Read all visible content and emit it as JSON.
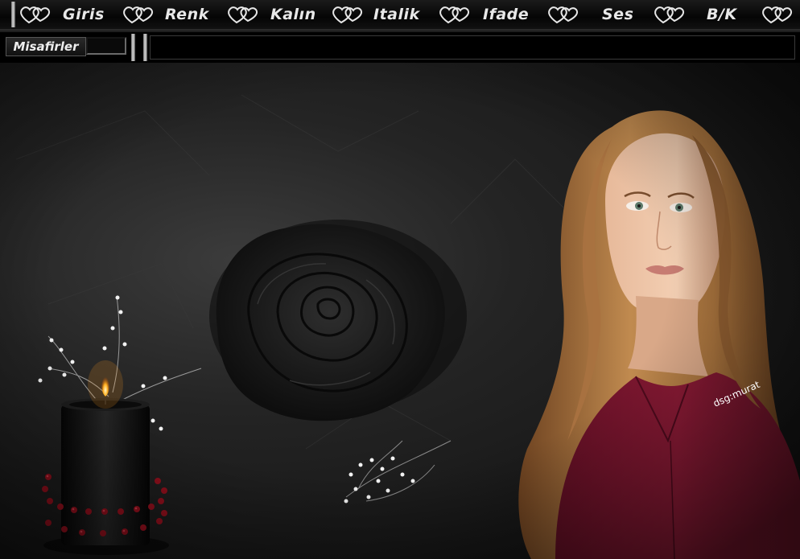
{
  "menu": {
    "items": [
      {
        "id": "giris",
        "label": "Giris"
      },
      {
        "id": "renk",
        "label": "Renk"
      },
      {
        "id": "kalin",
        "label": "Kalın"
      },
      {
        "id": "italik",
        "label": "Italik"
      },
      {
        "id": "ifade",
        "label": "Ifade"
      },
      {
        "id": "ses",
        "label": "Ses"
      },
      {
        "id": "bk",
        "label": "B/K"
      }
    ],
    "separator_icon": "double-heart-icon"
  },
  "guests": {
    "label": "Misafirler"
  },
  "artwork": {
    "credit": "dsg:murat",
    "elements": [
      "black-rose",
      "black-candle",
      "woman-portrait",
      "white-flower-sprigs"
    ],
    "colors": {
      "background": "#1c1c1c",
      "shirt": "#8a1a35",
      "hair": "#b9824a",
      "flame": "#ffb020",
      "beads": "#8e0f1c"
    }
  }
}
